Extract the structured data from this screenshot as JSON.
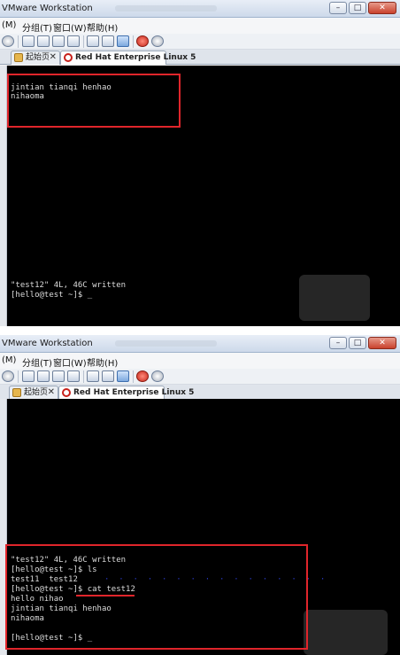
{
  "window": {
    "title": "VMware Workstation",
    "menu": [
      "(M)",
      "分组(T)",
      "窗口(W)",
      "帮助(H)"
    ],
    "tabs": {
      "home": "起始页",
      "vm": "Red Hat Enterprise Linux 5"
    }
  },
  "top_terminal": {
    "boxed_lines": [
      "jintian tianqi henhao",
      "nihaoma"
    ],
    "status_line": "\"test12\" 4L, 46C written",
    "prompt_line": "[hello@test ~]$ _"
  },
  "bottom_terminal": {
    "lines": [
      "\"test12\" 4L, 46C written",
      "[hello@test ~]$ ls",
      "test11  test12",
      "[hello@test ~]$ cat test12",
      "hello nihao",
      "jintian tianqi henhao",
      "nihaoma",
      "",
      "[hello@test ~]$ _"
    ]
  },
  "colors": {
    "annotation": "#e0252b",
    "terminal_bg": "#000000",
    "terminal_fg": "#dcdcdc"
  }
}
